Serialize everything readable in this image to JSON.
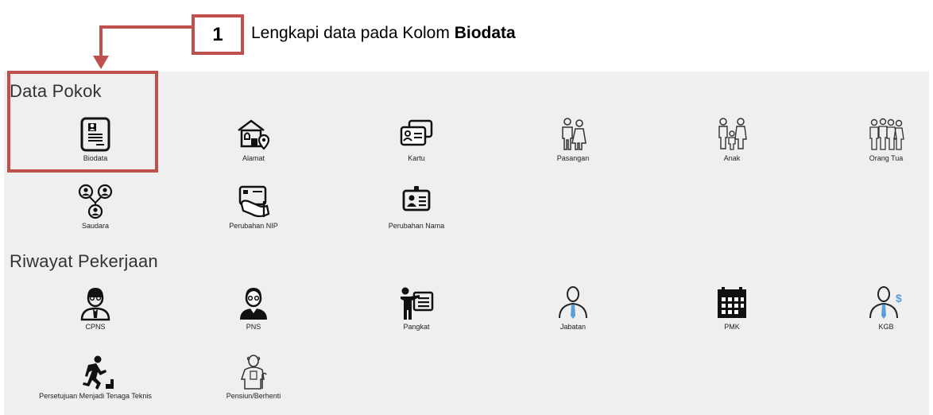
{
  "callout": {
    "number": "1",
    "text_prefix": "Lengkapi data pada Kolom ",
    "text_bold": "Biodata",
    "accent": "#c0504d"
  },
  "sections": {
    "data_pokok": {
      "title": "Data Pokok",
      "items": [
        {
          "label": "Biodata",
          "icon": "id-card-document-icon"
        },
        {
          "label": "Alamat",
          "icon": "house-location-icon"
        },
        {
          "label": "Kartu",
          "icon": "id-cards-icon"
        },
        {
          "label": "Pasangan",
          "icon": "couple-icon"
        },
        {
          "label": "Anak",
          "icon": "family-children-icon"
        },
        {
          "label": "Orang Tua",
          "icon": "elderly-parents-icon"
        },
        {
          "label": "Saudara",
          "icon": "siblings-network-icon"
        },
        {
          "label": "Perubahan NIP",
          "icon": "hand-card-icon"
        },
        {
          "label": "Perubahan Nama",
          "icon": "name-badge-icon"
        }
      ]
    },
    "riwayat_pekerjaan": {
      "title": "Riwayat Pekerjaan",
      "items": [
        {
          "label": "CPNS",
          "icon": "officer-outline-icon"
        },
        {
          "label": "PNS",
          "icon": "officer-suit-icon"
        },
        {
          "label": "Pangkat",
          "icon": "presenter-board-icon"
        },
        {
          "label": "Jabatan",
          "icon": "person-tie-icon"
        },
        {
          "label": "PMK",
          "icon": "calendar-icon"
        },
        {
          "label": "KGB",
          "icon": "person-salary-icon"
        },
        {
          "label": "Persetujuan Menjadi Tenaga Teknis",
          "icon": "climbing-stairs-icon"
        },
        {
          "label": "Pensiun/Berhenti",
          "icon": "old-man-cane-icon"
        }
      ]
    }
  }
}
